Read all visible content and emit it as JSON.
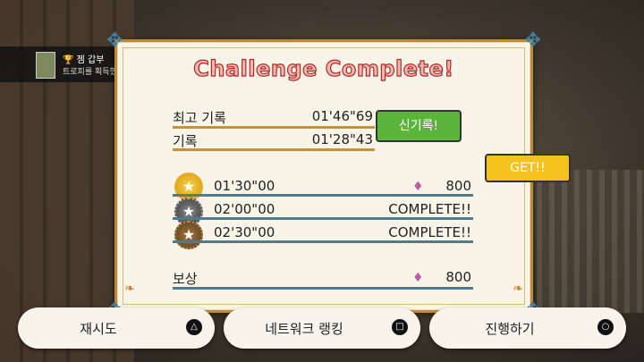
{
  "notification": {
    "trophy_glyph": "🏆",
    "title": "젬 갑부",
    "message": "트로피를 획득했습니다!",
    "platform_icon": "ps-logo-icon"
  },
  "card": {
    "title": "Challenge Complete!",
    "best_record": {
      "label": "최고 기록",
      "time": "01'46\"69"
    },
    "record": {
      "label": "기록",
      "time": "01'28\"43"
    },
    "goals": [
      {
        "medal": "gold-medal-icon",
        "time": "01'30\"00",
        "reward": "800",
        "status": ""
      },
      {
        "medal": "silver-medal-icon",
        "time": "02'00\"00",
        "reward": "",
        "status": "COMPLETE!!"
      },
      {
        "medal": "bronze-medal-icon",
        "time": "02'30\"00",
        "reward": "",
        "status": "COMPLETE!!"
      }
    ],
    "reward": {
      "label": "보상",
      "amount": "800"
    }
  },
  "bubbles": {
    "new_record": "신기록!",
    "get": "GET!!"
  },
  "buttons": {
    "retry": {
      "label": "재시도",
      "glyph": "△"
    },
    "ranking": {
      "label": "네트워크 랭킹",
      "glyph": "□"
    },
    "proceed": {
      "label": "진행하기",
      "glyph": "○"
    }
  },
  "colors": {
    "accent_gold": "#c08a3a",
    "accent_blue": "#4e7c8e",
    "title_red": "#b02a28",
    "bubble_green": "#5bb53a",
    "bubble_yellow": "#f4c21c"
  }
}
